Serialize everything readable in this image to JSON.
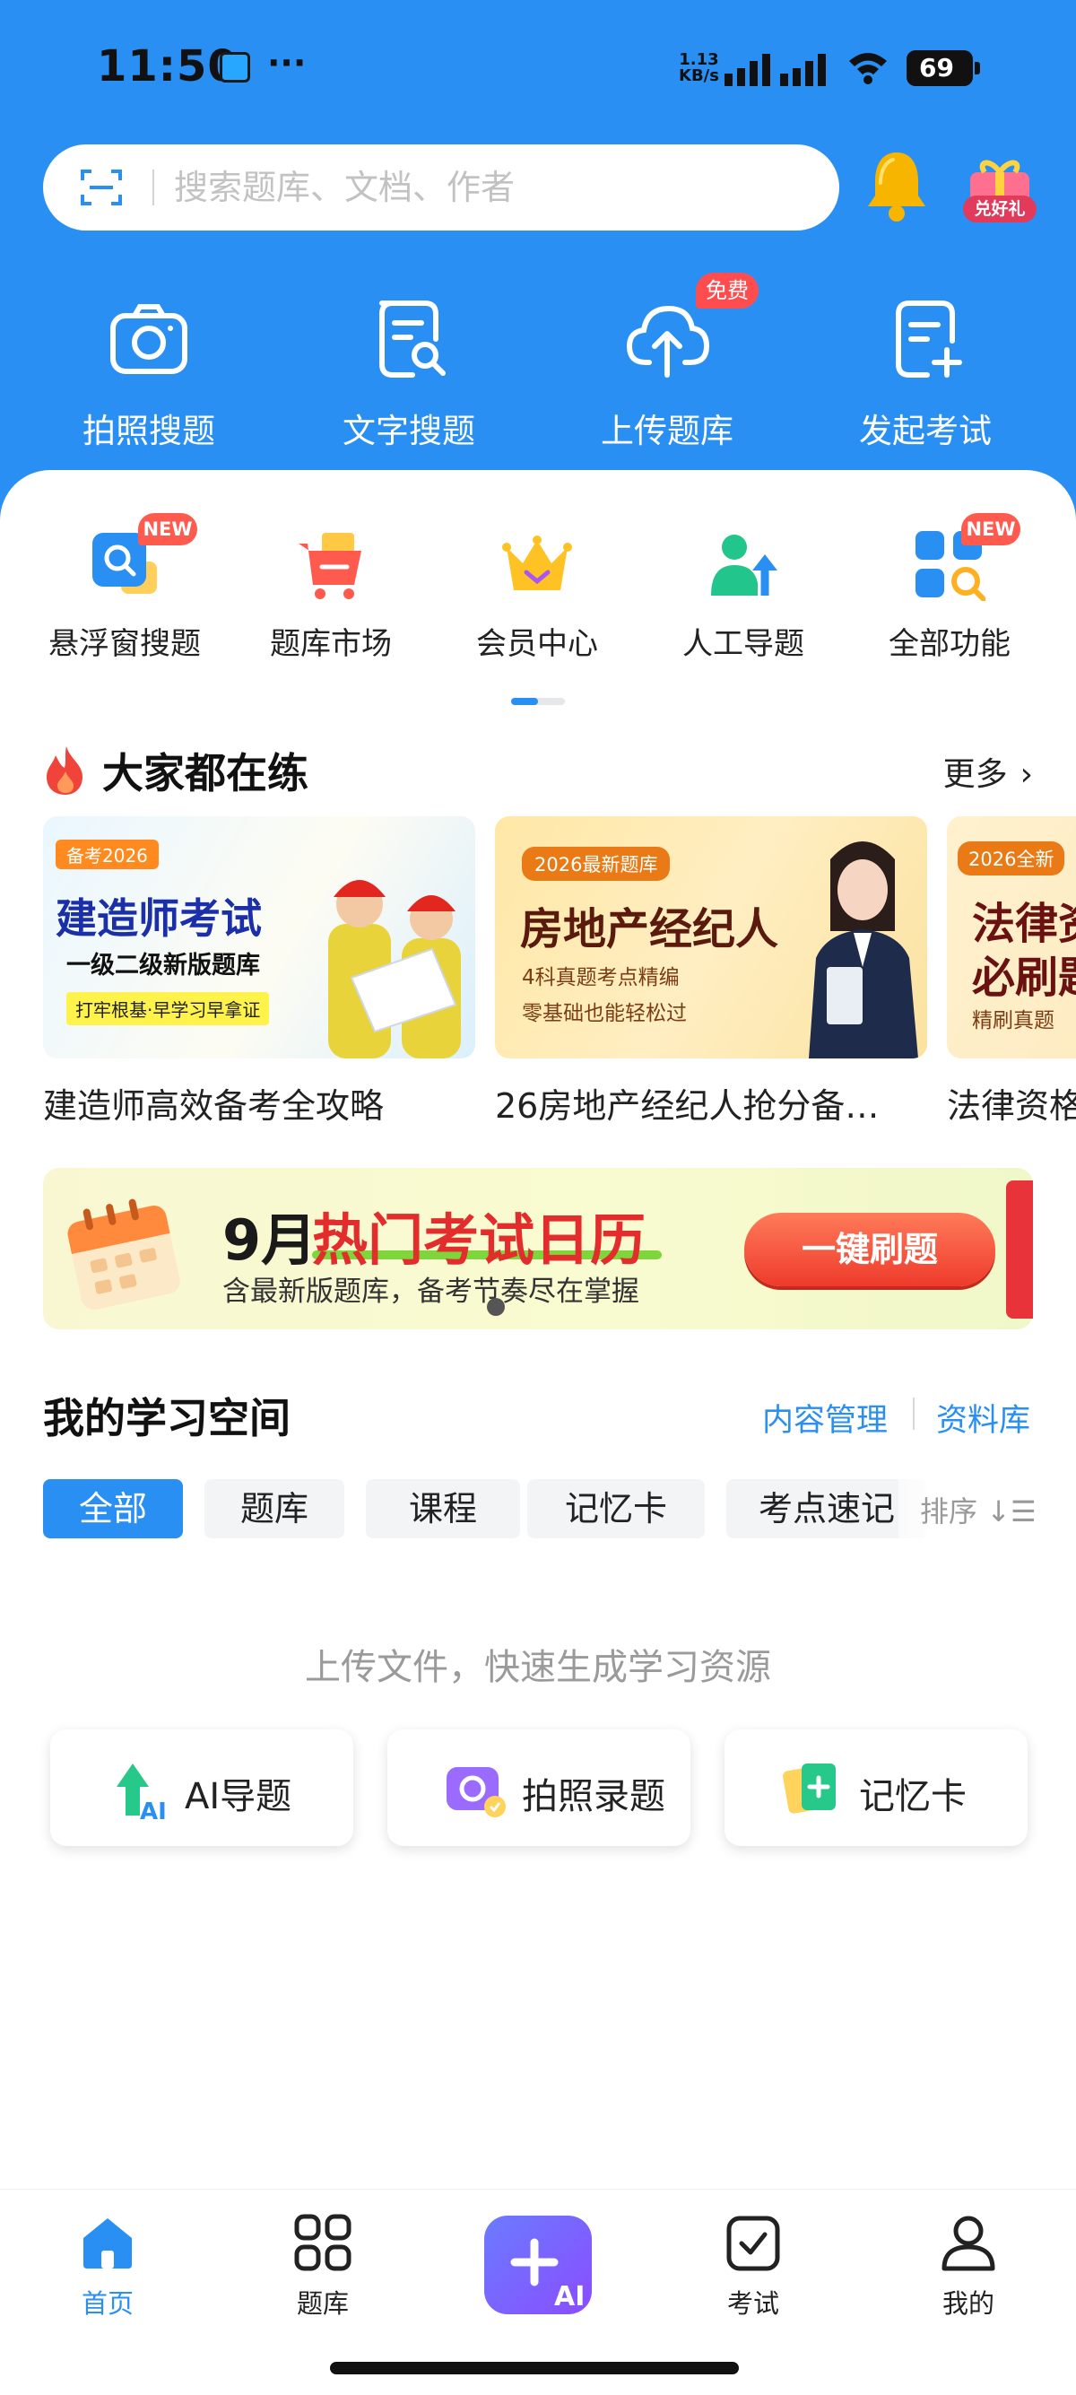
{
  "status_bar": {
    "time": "11:50",
    "dots": "···",
    "speed_value": "1.13",
    "speed_unit": "KB/s",
    "battery": "69"
  },
  "search": {
    "placeholder": "搜索题库、文档、作者"
  },
  "header": {
    "gift_label": "兑好礼"
  },
  "quick_tools": [
    {
      "label": "拍照搜题",
      "icon": "camera-icon"
    },
    {
      "label": "文字搜题",
      "icon": "doc-search-icon"
    },
    {
      "label": "上传题库",
      "icon": "cloud-upload-icon",
      "badge": "免费"
    },
    {
      "label": "发起考试",
      "icon": "doc-add-icon"
    }
  ],
  "features": [
    {
      "label": "悬浮窗搜题",
      "icon": "float-search-icon",
      "badge": "NEW"
    },
    {
      "label": "题库市场",
      "icon": "cart-icon"
    },
    {
      "label": "会员中心",
      "icon": "crown-icon"
    },
    {
      "label": "人工导题",
      "icon": "person-upload-icon"
    },
    {
      "label": "全部功能",
      "icon": "grid-search-icon",
      "badge": "NEW"
    }
  ],
  "practice": {
    "title": "大家都在练",
    "more": "更多",
    "cards": [
      {
        "tag": "备考2026",
        "headline": "建造师考试",
        "sub": "一级二级新版题库",
        "note": "打牢根基·早学习早拿证",
        "caption": "建造师高效备考全攻略"
      },
      {
        "tag": "2026最新题库",
        "headline": "房地产经纪人",
        "sub": "4科真题考点精编",
        "note": "零基础也能轻松过",
        "caption": "26房地产经纪人抢分备…"
      },
      {
        "tag": "2026全新",
        "headline": "法律资",
        "sub": "必刷题",
        "note": "精刷真题",
        "caption": "法律资格"
      }
    ]
  },
  "calendar_banner": {
    "title_prefix": "9月",
    "title_highlight": "热门考试日历",
    "subtitle": "含最新版题库，备考节奏尽在掌握",
    "button": "一键刷题"
  },
  "study_space": {
    "title": "我的学习空间",
    "links": [
      "内容管理",
      "资料库"
    ],
    "chips": [
      "全部",
      "题库",
      "课程",
      "记忆卡",
      "考点速记"
    ],
    "sort": "排序",
    "hint": "上传文件，快速生成学习资源",
    "actions": [
      {
        "label": "AI导题",
        "icon": "ai-upload-icon"
      },
      {
        "label": "拍照录题",
        "icon": "photo-record-icon"
      },
      {
        "label": "记忆卡",
        "icon": "flashcard-icon"
      }
    ]
  },
  "bottom_nav": [
    {
      "label": "首页",
      "icon": "home-icon",
      "active": true
    },
    {
      "label": "题库",
      "icon": "grid-icon"
    },
    {
      "label": "",
      "icon": "ai-plus-icon"
    },
    {
      "label": "考试",
      "icon": "exam-check-icon"
    },
    {
      "label": "我的",
      "icon": "profile-icon"
    }
  ],
  "colors": {
    "brand_blue": "#2a8ff3",
    "badge_red": "#ff4d4f",
    "cta_red": "#ee3b2b"
  }
}
